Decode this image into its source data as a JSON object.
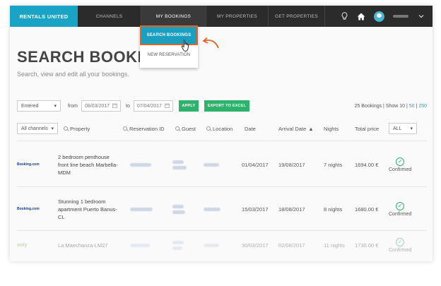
{
  "nav": {
    "brand": "RENTALS UNITED",
    "items": [
      "CHANNELS",
      "MY BOOKINGS",
      "MY PROPERTIES",
      "GET PROPERTIES"
    ],
    "dropdown": [
      "SEARCH BOOKINGS",
      "NEW RESERVATION"
    ]
  },
  "page": {
    "title": "SEARCH BOOKINGS",
    "subtitle": "Search, view and edit all your bookings."
  },
  "filters": {
    "entered_label": "Entered",
    "from_label": "from",
    "from_value": "08/03/2017",
    "to_label": "to",
    "to_value": "07/04/2017",
    "apply": "APPLY",
    "export": "EXPORT TO EXCEL",
    "summary_text": "25 Bookings | Show 10 |",
    "show_50": "50",
    "sep": "|",
    "show_250": "250"
  },
  "table": {
    "channels_select": "All channels",
    "columns": [
      "Property",
      "Reservation ID",
      "Guest",
      "Location",
      "Date",
      "Arrival Date",
      "Nights",
      "Total price"
    ],
    "status_select": "ALL",
    "rows": [
      {
        "channel": "Booking.com",
        "property": "2 bedroom penthouse front line beach Marbella-MDM",
        "date": "01/04/2017",
        "arrival": "19/08/2017",
        "nights": "7 nights",
        "price": "1694.00 €",
        "status": "Confirmed"
      },
      {
        "channel": "Booking.com",
        "property": "Stunning 1 bedroom apartment Puerto Banus-CL",
        "date": "15/03/2017",
        "arrival": "18/08/2017",
        "nights": "8 nights",
        "price": "1680.00 €",
        "status": "Confirmed"
      },
      {
        "channel": "only",
        "property": "La Maechanza-LM27",
        "date": "30/03/2017",
        "arrival": "02/08/2017",
        "nights": "11 nights",
        "price": "1730.00 €",
        "status": "Confirmed"
      }
    ]
  },
  "colors": {
    "brand": "#19a3c4",
    "nav_bg": "#2b2b2b",
    "green": "#2db36b",
    "highlight_border": "#e8631f"
  }
}
